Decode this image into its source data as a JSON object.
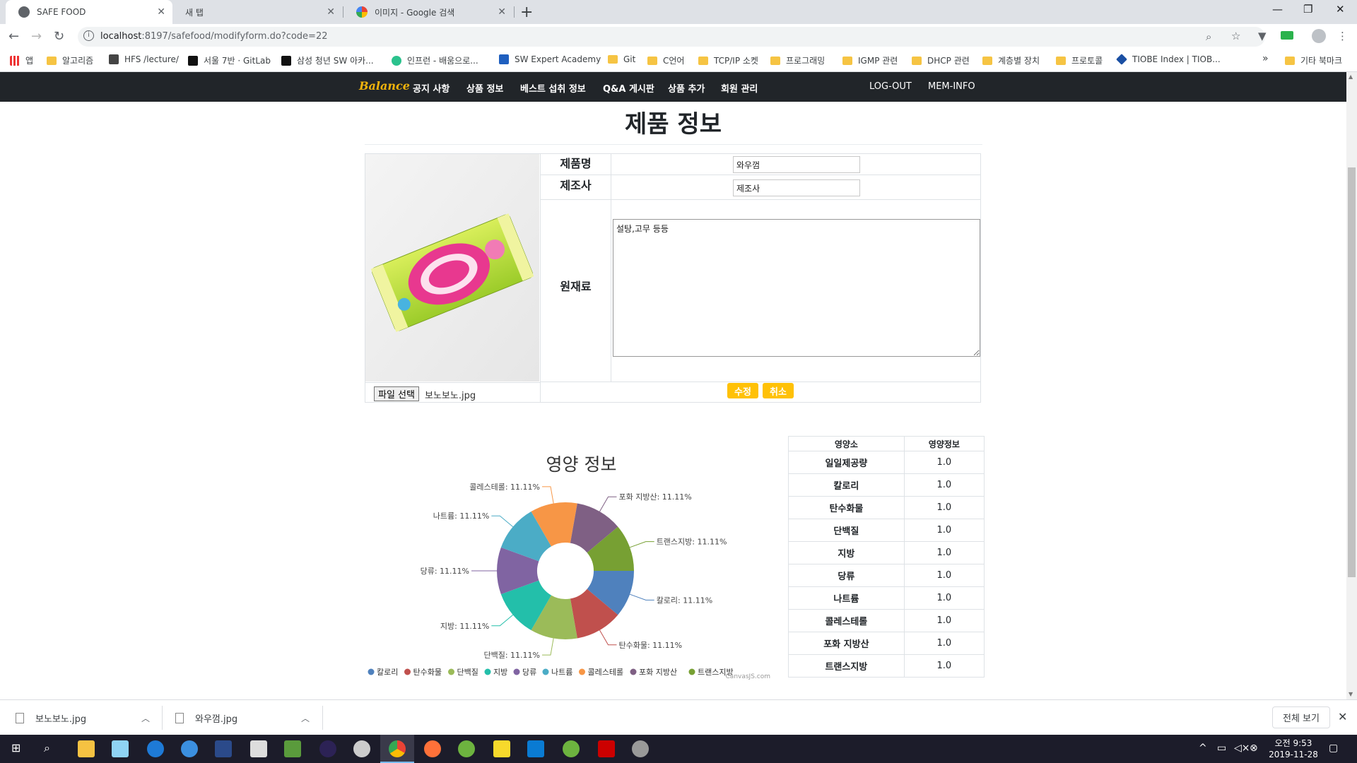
{
  "browser": {
    "tabs": [
      {
        "title": "SAFE FOOD",
        "active": true
      },
      {
        "title": "새 탭",
        "active": false
      },
      {
        "title": "이미지 - Google 검색",
        "active": false
      }
    ],
    "url_host": "localhost",
    "url_rest": ":8197/safefood/modifyform.do?code=22",
    "bookmarks": [
      {
        "label": "앱",
        "icon": "apps-grid-icon"
      },
      {
        "label": "알고리즘",
        "icon": "folder-icon"
      },
      {
        "label": "HFS /lecture/",
        "icon": "hfs-icon"
      },
      {
        "label": "서울 7반 · GitLab",
        "icon": "gitlab-icon"
      },
      {
        "label": "삼성 청년 SW 아카...",
        "icon": "ssafy-icon"
      },
      {
        "label": "인프런 - 배움으로...",
        "icon": "inflearn-icon"
      },
      {
        "label": "SW Expert Academy",
        "icon": "swea-icon"
      },
      {
        "label": "Git",
        "icon": "folder-icon"
      },
      {
        "label": "C언어",
        "icon": "folder-icon"
      },
      {
        "label": "TCP/IP 소켓",
        "icon": "folder-icon"
      },
      {
        "label": "프로그래밍",
        "icon": "folder-icon"
      },
      {
        "label": "IGMP 관련",
        "icon": "folder-icon"
      },
      {
        "label": "DHCP 관련",
        "icon": "folder-icon"
      },
      {
        "label": "계층별 장치",
        "icon": "folder-icon"
      },
      {
        "label": "프로토콜",
        "icon": "folder-icon"
      },
      {
        "label": "TIOBE Index | TIOB...",
        "icon": "tiobe-icon"
      }
    ],
    "bookmarks_more": "»",
    "other_bookmarks": "기타 북마크"
  },
  "site_nav": {
    "brand": "Balance",
    "links": [
      "공지 사항",
      "상품 정보",
      "베스트 섭취 정보",
      "Q&A 게시판",
      "상품 추가",
      "회원 관리"
    ],
    "right_links": [
      "LOG-OUT",
      "MEM-INFO"
    ]
  },
  "page": {
    "title": "제품 정보"
  },
  "product_form": {
    "name_label": "제품명",
    "name_value": "와우껌",
    "maker_label": "제조사",
    "maker_value": "제조사",
    "ingredients_label": "원재료",
    "ingredients_value": "설탕,고무 등등",
    "file_button": "파일 선택",
    "file_name": "보노보노.jpg",
    "submit_label": "수정",
    "cancel_label": "취소"
  },
  "chart_data": {
    "type": "pie",
    "title": "영양 정보",
    "donut": true,
    "categories": [
      "칼로리",
      "탄수화물",
      "단백질",
      "지방",
      "당류",
      "나트륨",
      "콜레스테롤",
      "포화 지방산",
      "트랜스지방"
    ],
    "values": [
      11.11,
      11.11,
      11.11,
      11.11,
      11.11,
      11.11,
      11.11,
      11.11,
      11.11
    ],
    "colors": [
      "#4f81bd",
      "#c0504d",
      "#9bbb59",
      "#23bfaa",
      "#8064a2",
      "#4bacc6",
      "#f79646",
      "#7f6084",
      "#77a033"
    ],
    "label_suffix": "%",
    "legend_position": "bottom",
    "watermark": "CanvasJS.com"
  },
  "nutrition_table": {
    "headers": [
      "영양소",
      "영양정보"
    ],
    "rows": [
      [
        "일일제공량",
        "1.0"
      ],
      [
        "칼로리",
        "1.0"
      ],
      [
        "탄수화물",
        "1.0"
      ],
      [
        "단백질",
        "1.0"
      ],
      [
        "지방",
        "1.0"
      ],
      [
        "당류",
        "1.0"
      ],
      [
        "나트륨",
        "1.0"
      ],
      [
        "콜레스테롤",
        "1.0"
      ],
      [
        "포화 지방산",
        "1.0"
      ],
      [
        "트랜스지방",
        "1.0"
      ]
    ]
  },
  "downloads": {
    "items": [
      "보노보노.jpg",
      "와우껌.jpg"
    ],
    "show_all": "전체 보기"
  },
  "taskbar": {
    "time": "오전 9:53",
    "date": "2019-11-28"
  }
}
